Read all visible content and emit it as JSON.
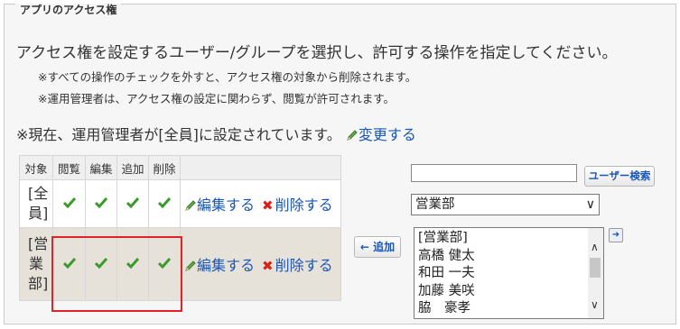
{
  "section": {
    "title": "アプリのアクセス権"
  },
  "intro": "アクセス権を設定するユーザー/グループを選択し、許可する操作を指定してください。",
  "notes": [
    "※すべての操作のチェックを外すと、アクセス権の対象から削除されます。",
    "※運用管理者は、アクセス権の設定に関わらず、閲覧が許可されます。"
  ],
  "current": {
    "text": "※現在、運用管理者が[全員]に設定されています。",
    "change_link": "変更する"
  },
  "table": {
    "headers": [
      "対象",
      "閲覧",
      "編集",
      "追加",
      "削除",
      ""
    ],
    "rows": [
      {
        "target_lines": [
          "[全",
          "員]"
        ],
        "view": true,
        "edit": true,
        "add": true,
        "delete": true,
        "edit_link": "編集する",
        "delete_link": "削除する"
      },
      {
        "target_lines": [
          "[営",
          "業",
          "部]"
        ],
        "view": true,
        "edit": true,
        "add": true,
        "delete": true,
        "edit_link": "編集する",
        "delete_link": "削除する"
      }
    ]
  },
  "add_button": "← 追加",
  "search": {
    "value": "",
    "button": "ユーザー検索"
  },
  "group_select": {
    "selected": "営業部"
  },
  "user_list": [
    "[営業部]",
    "高橋 健太",
    "和田 一夫",
    "加藤 美咲",
    "脇　豪孝"
  ],
  "colors": {
    "check": "#3c9a2c",
    "link": "#1a56b5",
    "delete_x": "#d8231a",
    "highlight": "#e0232b"
  },
  "icons": {
    "check": "check-icon",
    "pencil": "pencil-icon",
    "delete": "x-icon"
  }
}
